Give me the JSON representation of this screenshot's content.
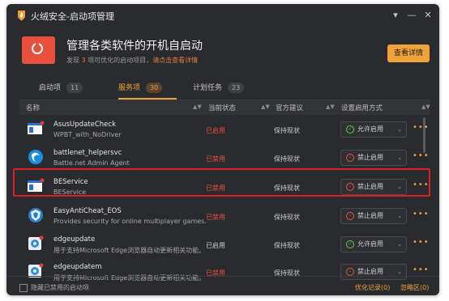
{
  "window": {
    "title": "火绒安全-启动项管理",
    "controls": {
      "menu": "▾",
      "minimize": "—",
      "close": "✕"
    }
  },
  "hero": {
    "title": "管理各类软件的开机自启动",
    "subtitle_prefix": "发现",
    "subtitle_count": "3",
    "subtitle_mid": "项可优化的启动项目，",
    "subtitle_link": "请点击查看详情",
    "detail_button": "查看详情"
  },
  "tabs": [
    {
      "label": "启动项",
      "count": "11",
      "active": false
    },
    {
      "label": "服务项",
      "count": "30",
      "active": true
    },
    {
      "label": "计划任务",
      "count": "23",
      "active": false
    }
  ],
  "columns": {
    "name": "名称",
    "status": "当前状态",
    "advice": "官方建议",
    "setting": "设置启用方式"
  },
  "rows": [
    {
      "name": "AsusUpdateCheck",
      "desc": "WPBT_with_NoDriver",
      "status": "已启用",
      "status_color": "#e8503c",
      "advice": "保持现状",
      "setting": "允许启用",
      "setting_kind": "allow",
      "icon": "window-app-icon"
    },
    {
      "name": "battlenet_helpersvc",
      "desc": "Battle.net Admin Agent",
      "status": "已禁用",
      "status_color": "#e8503c",
      "advice": "保持现状",
      "setting": "禁止启用",
      "setting_kind": "deny",
      "icon": "battlenet-icon"
    },
    {
      "name": "BEService",
      "desc": "BEService",
      "status": "已禁用",
      "status_color": "#e8503c",
      "advice": "保持现状",
      "setting": "禁止启用",
      "setting_kind": "deny",
      "icon": "window-app-icon"
    },
    {
      "name": "EasyAntiCheat_EOS",
      "desc": "Provides security for online multiplayer games.",
      "status": "已禁用",
      "status_color": "#e8503c",
      "advice": "保持现状",
      "setting": "禁止启用",
      "setting_kind": "deny",
      "icon": "easyanticheat-icon"
    },
    {
      "name": "edgeupdate",
      "desc": "用于支持Microsoft Edge浏览器自动更新相关功能。",
      "status": "已启用",
      "status_color": "#d0d0d0",
      "advice": "保持现状",
      "setting": "允许启用",
      "setting_kind": "allow",
      "icon": "edge-update-icon"
    },
    {
      "name": "edgeupdatem",
      "desc": "用于支持Microsoft Edge浏览器自动更新相关功能。",
      "status": "已禁用",
      "status_color": "#e8503c",
      "advice": "保持现状",
      "setting": "禁止启用",
      "setting_kind": "deny",
      "icon": "edge-update-icon"
    }
  ],
  "footer": {
    "hide_disabled": "隐藏已禁用的启动项",
    "optimize_link": "优化记录(0)",
    "ignore_link": "忽略区(0)"
  },
  "colors": {
    "accent": "#f0a33a",
    "danger": "#e8503c",
    "allow": "#6cc24a"
  }
}
